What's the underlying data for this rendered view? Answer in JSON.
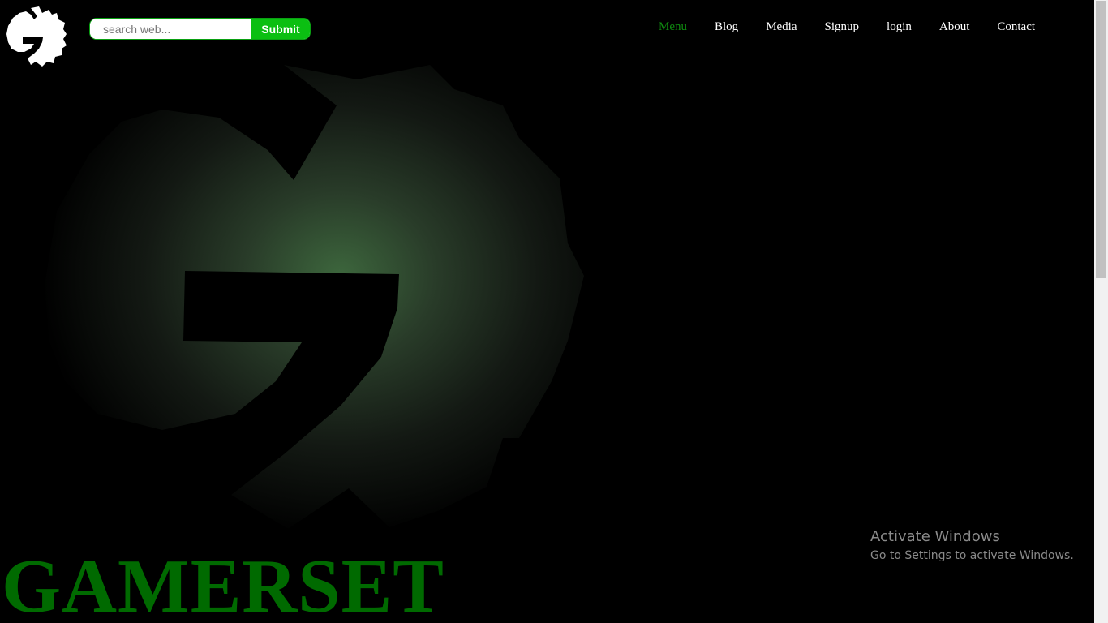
{
  "search": {
    "placeholder": "search web...",
    "submit_label": "Submit"
  },
  "nav": {
    "items": [
      {
        "label": "Menu",
        "active": true
      },
      {
        "label": "Blog"
      },
      {
        "label": "Media"
      },
      {
        "label": "Signup"
      },
      {
        "label": "login"
      },
      {
        "label": "About"
      },
      {
        "label": "Contact"
      }
    ]
  },
  "hero": {
    "title": "GAMERSET"
  },
  "watermark": {
    "title": "Activate Windows",
    "subtitle": "Go to Settings to activate Windows."
  },
  "colors": {
    "accent": "#0bbf12",
    "nav_active": "#0f8a10",
    "title": "#006a00",
    "background": "#000000"
  },
  "icons": {
    "logo": "gear-g-logo-icon",
    "hero_emblem": "gear-g-emblem-icon"
  }
}
